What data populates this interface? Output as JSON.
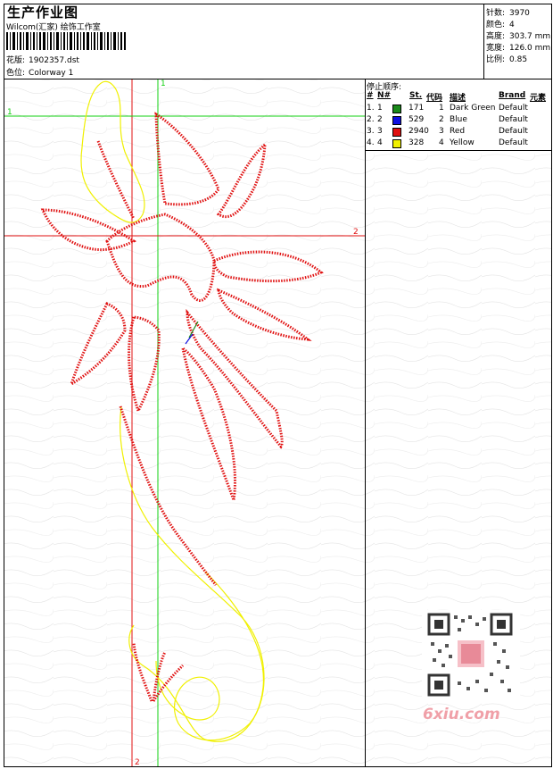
{
  "header": {
    "title": "生产作业图",
    "company": "Wilcom(汇家) 绘饰工作室",
    "design_label": "花版:",
    "design_value": "1902357.dst",
    "colorway_label": "色位:",
    "colorway_value": "Colorway 1"
  },
  "stats": [
    {
      "label": "针数:",
      "value": "3970"
    },
    {
      "label": "颜色:",
      "value": "4"
    },
    {
      "label": "高度:",
      "value": "303.7 mm"
    },
    {
      "label": "宽度:",
      "value": "126.0 mm"
    },
    {
      "label": "比例:",
      "value": "0.85"
    }
  ],
  "stop_sequence": {
    "title": "停止顺序:",
    "headers": {
      "num": "#",
      "no": "N#",
      "st": "St.",
      "code": "代码",
      "desc": "描述",
      "brand": "Brand",
      "element": "元素"
    },
    "rows": [
      {
        "num": "1.",
        "no": "1",
        "color": "#1a8a1a",
        "st": "171",
        "code": "1",
        "desc": "Dark Green",
        "brand": "Default"
      },
      {
        "num": "2.",
        "no": "2",
        "color": "#1010e0",
        "st": "529",
        "code": "2",
        "desc": "Blue",
        "brand": "Default"
      },
      {
        "num": "3.",
        "no": "3",
        "color": "#e01010",
        "st": "2940",
        "code": "3",
        "desc": "Red",
        "brand": "Default"
      },
      {
        "num": "4.",
        "no": "4",
        "color": "#f0f000",
        "st": "328",
        "code": "4",
        "desc": "Yellow",
        "brand": "Default"
      }
    ]
  },
  "guides": {
    "red_h": "2",
    "red_v": "2",
    "green_h": "1",
    "green_v": "1"
  },
  "watermark": "6xiu.com"
}
